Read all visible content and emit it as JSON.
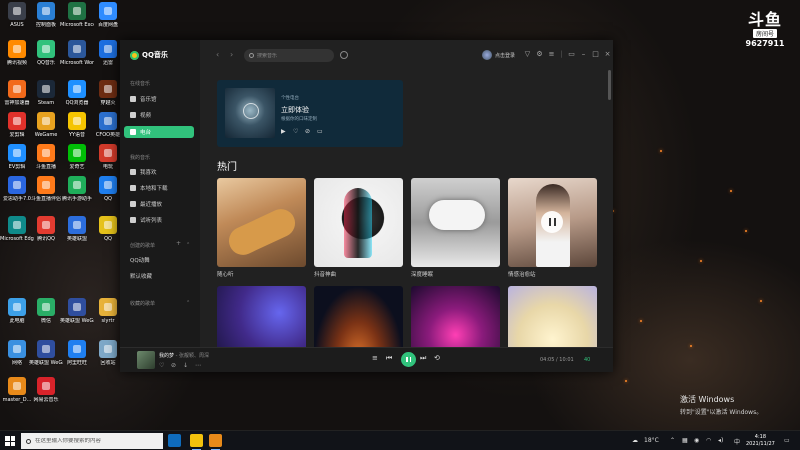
{
  "desktop": {
    "icons": [
      {
        "label": "ASUS",
        "color": "#3a3f4a"
      },
      {
        "label": "控制面板",
        "color": "#2a7fd4"
      },
      {
        "label": "Microsoft Excel 2010",
        "color": "#1f7244"
      },
      {
        "label": "百度网盘",
        "color": "#2f8cff"
      },
      {
        "label": "腾讯视频",
        "color": "#ff8a00"
      },
      {
        "label": "QQ音乐",
        "color": "#31c27c"
      },
      {
        "label": "Microsoft Word 2010",
        "color": "#2b579a"
      },
      {
        "label": "迅雷",
        "color": "#1d6fe0"
      },
      {
        "label": "雷神加速器",
        "color": "#f26a1b"
      },
      {
        "label": "Steam",
        "color": "#1b2838"
      },
      {
        "label": "QQ浏览器",
        "color": "#1e90ff"
      },
      {
        "label": "穿越火",
        "color": "#6d2c12"
      },
      {
        "label": "爱剪辑",
        "color": "#e0312b"
      },
      {
        "label": "WeGame",
        "color": "#e8a21f"
      },
      {
        "label": "YY语音",
        "color": "#f5c400"
      },
      {
        "label": "CFOO英雄",
        "color": "#2b6fce"
      },
      {
        "label": "EV剪辑",
        "color": "#1f8fff"
      },
      {
        "label": "斗鱼直播",
        "color": "#ff7a1a"
      },
      {
        "label": "爱奇艺",
        "color": "#00be06"
      },
      {
        "label": "电玩",
        "color": "#d23a2a"
      },
      {
        "label": "爱思助手7.0",
        "color": "#2a66e0"
      },
      {
        "label": "斗鱼直播伴侣",
        "color": "#ff7a1a"
      },
      {
        "label": "腾讯手游助手",
        "color": "#1fae5a"
      },
      {
        "label": "QQ",
        "color": "#1f7ff0"
      },
      {
        "label": "Microsoft Edge",
        "color": "#0f8a8a"
      },
      {
        "label": "腾讯QQ",
        "color": "#e23b30"
      },
      {
        "label": "英雄联盟",
        "color": "#2c6ddc"
      },
      {
        "label": "QQ",
        "color": "#e6c21b"
      },
      {
        "label": "此电脑",
        "color": "#3da0e8"
      },
      {
        "label": "微信",
        "color": "#2aae67"
      },
      {
        "label": "英雄联盟 WeGame版",
        "color": "#2f4e9e"
      },
      {
        "label": "slyrtr",
        "color": "#e8b23a"
      },
      {
        "label": "网络",
        "color": "#3a90e0"
      },
      {
        "label": "英雄联盟 WeGame版",
        "color": "#2f4e9e"
      },
      {
        "label": "阿里旺旺",
        "color": "#1f7ff0"
      },
      {
        "label": "回收站",
        "color": "#7ea8c8"
      },
      {
        "label": "master_D...",
        "color": "#e88a1a"
      },
      {
        "label": "网易云音乐",
        "color": "#d8232a"
      }
    ]
  },
  "watermark": {
    "brand": "斗鱼",
    "room_label": "房间号",
    "room_number": "9627911"
  },
  "activation": {
    "title": "激活 Windows",
    "subtitle": "转到\"设置\"以激活 Windows。"
  },
  "app": {
    "name": "QQ音乐",
    "sidebar": {
      "online_section": "在线音乐",
      "items": [
        {
          "label": "音乐馆"
        },
        {
          "label": "视频"
        },
        {
          "label": "电台"
        }
      ],
      "my_music_section": "我的音乐",
      "my_items": [
        {
          "label": "我喜欢"
        },
        {
          "label": "本地和下载"
        },
        {
          "label": "最近播放"
        },
        {
          "label": "试听列表"
        }
      ],
      "created_section": "创建的歌单",
      "created_items": [
        {
          "label": "QQ动舞"
        },
        {
          "label": "默认收藏"
        }
      ],
      "collected_section": "收藏的歌单"
    },
    "topbar": {
      "search_placeholder": "搜索音乐",
      "login_label": "点击登录"
    },
    "banner": {
      "tag": "个性电台",
      "title": "立即体验",
      "subtitle": "根据你的口味定制"
    },
    "hot_title": "热门",
    "cards": [
      {
        "caption": "随心听"
      },
      {
        "caption": "抖音神曲"
      },
      {
        "caption": "深度睡眠"
      },
      {
        "caption": "情感治愈站"
      },
      {
        "caption": ""
      },
      {
        "caption": ""
      },
      {
        "caption": ""
      },
      {
        "caption": ""
      }
    ],
    "player": {
      "title": "我的梦",
      "artist": "- 张靓颖、周深",
      "time": "04:05 / 10:01",
      "count": "40"
    }
  },
  "taskbar": {
    "search_placeholder": "在这里输入你要搜索的内容",
    "temperature": "18°C",
    "ime": "中",
    "time": "4:18",
    "date": "2021/11/27"
  }
}
